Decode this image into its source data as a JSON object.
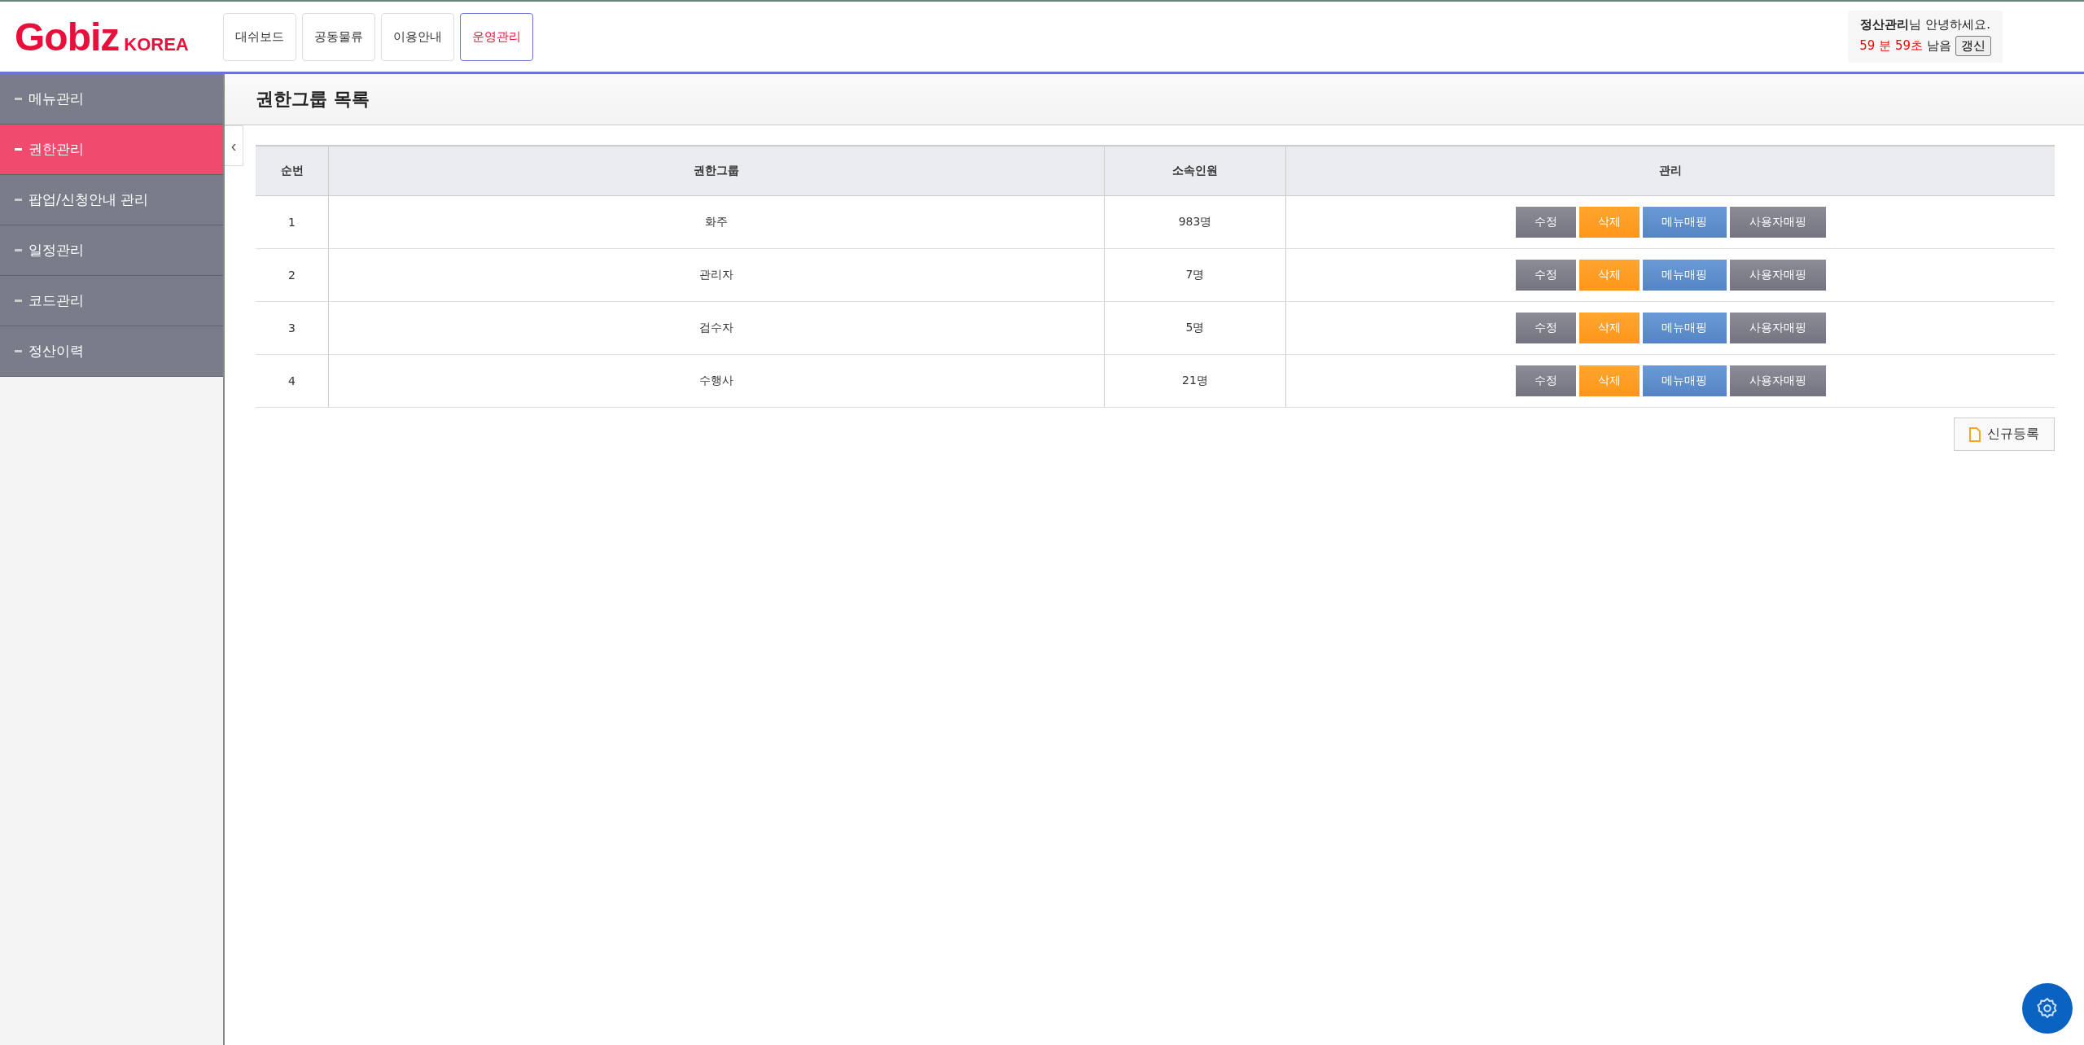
{
  "logo": {
    "brand": "Gobiz",
    "suffix": "KOREA"
  },
  "nav_tabs": [
    {
      "label": "대쉬보드",
      "selected": false
    },
    {
      "label": "공동물류",
      "selected": false
    },
    {
      "label": "이용안내",
      "selected": false
    },
    {
      "label": "운영관리",
      "selected": true
    }
  ],
  "user_box": {
    "name": "정산관리",
    "greeting": "님 안녕하세요.",
    "timer": "59 분 59초",
    "remaining": "남음",
    "refresh_button": "갱신"
  },
  "sidebar": {
    "items": [
      {
        "label": "메뉴관리",
        "selected": false
      },
      {
        "label": "권한관리",
        "selected": true
      },
      {
        "label": "팝업/신청안내 관리",
        "selected": false
      },
      {
        "label": "일정관리",
        "selected": false
      },
      {
        "label": "코드관리",
        "selected": false
      },
      {
        "label": "정산이력",
        "selected": false
      }
    ],
    "collapse_button": "‹"
  },
  "page_title": "권한그룹 목록",
  "table": {
    "columns": [
      "순번",
      "권한그룹",
      "소속인원",
      "관리"
    ],
    "rows": [
      {
        "no": "1",
        "group": "화주",
        "members": "983명",
        "actions": [
          {
            "label": "수정",
            "kind": "edit"
          },
          {
            "label": "삭제",
            "kind": "delete"
          },
          {
            "label": "메뉴매핑",
            "kind": "menu"
          },
          {
            "label": "사용자매핑",
            "kind": "user"
          }
        ]
      },
      {
        "no": "2",
        "group": "관리자",
        "members": "7명",
        "actions": [
          {
            "label": "수정",
            "kind": "edit"
          },
          {
            "label": "삭제",
            "kind": "delete"
          },
          {
            "label": "메뉴매핑",
            "kind": "menu"
          },
          {
            "label": "사용자매핑",
            "kind": "user"
          }
        ]
      },
      {
        "no": "3",
        "group": "검수자",
        "members": "5명",
        "actions": [
          {
            "label": "수정",
            "kind": "edit"
          },
          {
            "label": "삭제",
            "kind": "delete"
          },
          {
            "label": "메뉴매핑",
            "kind": "menu"
          },
          {
            "label": "사용자매핑",
            "kind": "user"
          }
        ]
      },
      {
        "no": "4",
        "group": "수행사",
        "members": "21명",
        "actions": [
          {
            "label": "수정",
            "kind": "edit"
          },
          {
            "label": "삭제",
            "kind": "delete"
          },
          {
            "label": "메뉴매핑",
            "kind": "menu"
          },
          {
            "label": "사용자매핑",
            "kind": "user"
          }
        ]
      }
    ]
  },
  "new_button": "신규등록"
}
